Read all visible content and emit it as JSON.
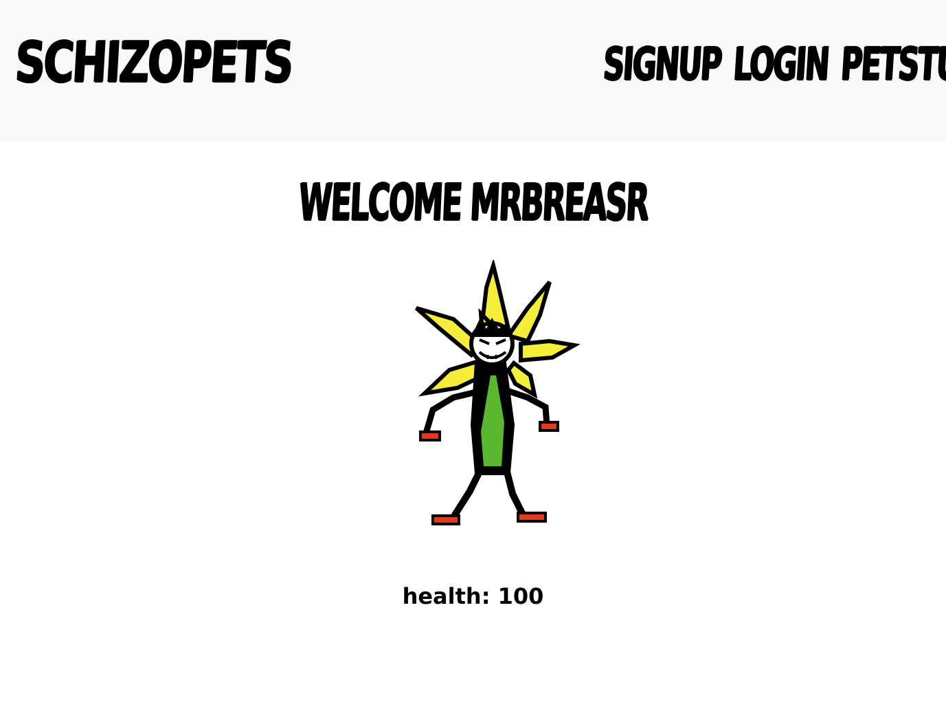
{
  "header": {
    "logo": "SCHIZOPETS",
    "nav": [
      {
        "label": "SIGNUP"
      },
      {
        "label": "LOGIN"
      },
      {
        "label": "PETSTUFF"
      }
    ]
  },
  "main": {
    "welcome_prefix": "WELCOME ",
    "username": "MRBREASR",
    "pet_image": "flower-creature-pet",
    "health_label": "health:",
    "health_value": "100"
  },
  "colors": {
    "header_bg": "#f9f9f9",
    "petal_yellow": "#f4ee3a",
    "stem_green": "#5bb82e",
    "shoe_red": "#e03a1e"
  }
}
